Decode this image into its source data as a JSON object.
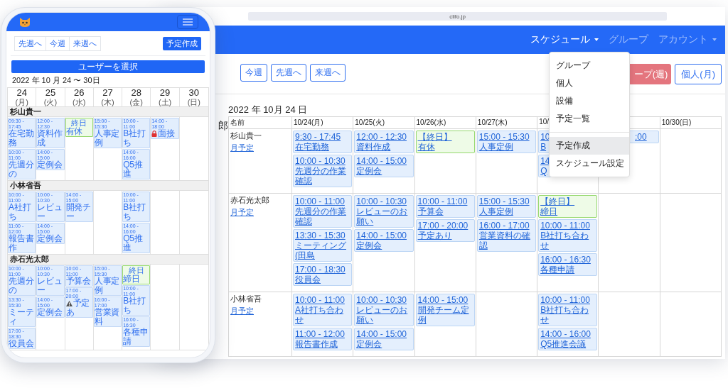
{
  "browser": {
    "url": "clifo.jp"
  },
  "navbar": {
    "items": [
      {
        "label": "スケジュール",
        "active": true,
        "dropdown": true
      },
      {
        "label": "グループ",
        "active": false,
        "dropdown": false
      },
      {
        "label": "アカウント",
        "active": false,
        "dropdown": true
      }
    ]
  },
  "dropdown": {
    "sections": [
      [
        {
          "label": "グループ",
          "selected": false
        },
        {
          "label": "個人",
          "selected": false
        },
        {
          "label": "設備",
          "selected": false
        },
        {
          "label": "予定一覧",
          "selected": false
        }
      ],
      [
        {
          "label": "予定作成",
          "selected": true
        },
        {
          "label": "スケジュール設定",
          "selected": false
        }
      ]
    ]
  },
  "toolbar": {
    "nav_buttons": [
      "今週",
      "先週へ",
      "来週へ"
    ],
    "view_buttons": [
      {
        "label": "ープ(週)",
        "selected": true
      },
      {
        "label": "個人(月)",
        "selected": false
      }
    ]
  },
  "sidebar_fragment": "郎",
  "date_title": "2022 年 10月 24 日",
  "table": {
    "columns": [
      {
        "label": "名前"
      },
      {
        "label": "10/24(月)"
      },
      {
        "label": "10/25(火)"
      },
      {
        "label": "10/26(水)"
      },
      {
        "label": "10/27(木)"
      },
      {
        "label": "10/"
      },
      {},
      {
        "label": "10/30(日)"
      }
    ],
    "rows": [
      {
        "name": "杉山貴一",
        "link": "月予定",
        "days": [
          {
            "events": [
              {
                "kind": "timed",
                "time": "9:30 - 17:45",
                "title": "在宅勤務"
              },
              {
                "kind": "timed",
                "time": "10:00 - 10:30",
                "title": "先週分の作業確認"
              }
            ]
          },
          {
            "events": [
              {
                "kind": "timed",
                "time": "12:00 - 12:30",
                "title": "資料作成"
              },
              {
                "kind": "timed",
                "time": "14:00 - 15:00",
                "title": "定例会"
              }
            ]
          },
          {
            "events": [
              {
                "kind": "allday",
                "time": "【終日】",
                "title": "有休"
              }
            ]
          },
          {
            "events": [
              {
                "kind": "timed",
                "time": "15:00 - 15:30",
                "title": "人事定例"
              }
            ]
          },
          {
            "events": [
              {
                "kind": "cut_right",
                "time": "10",
                "title": "B"
              },
              {
                "kind": "cut_right",
                "time": "14",
                "title": "Q"
              }
            ]
          },
          {
            "events": [
              {
                "kind": "cut_left",
                "time": ":00"
              }
            ]
          }
        ]
      },
      {
        "name": "赤石光太郎",
        "link": "月予定",
        "days": [
          {
            "events": [
              {
                "kind": "timed",
                "time": "10:00 - 11:00",
                "title": "先週分の作業確認"
              },
              {
                "kind": "timed",
                "time": "13:30 - 15:30",
                "title": "ミーティング(田島"
              },
              {
                "kind": "timed",
                "time": "17:00 - 18:30",
                "title": "役員会"
              }
            ]
          },
          {
            "events": [
              {
                "kind": "timed",
                "time": "10:00 - 10:30",
                "title": "レビューのお願い"
              },
              {
                "kind": "timed",
                "time": "14:00 - 15:00",
                "title": "定例会"
              }
            ]
          },
          {
            "events": [
              {
                "kind": "timed",
                "time": "10:00 - 11:00",
                "title": "予算会"
              },
              {
                "kind": "timed",
                "time": "17:00 - 20:00",
                "title": "予定あり"
              }
            ]
          },
          {
            "events": [
              {
                "kind": "timed",
                "time": "15:00 - 15:30",
                "title": "人事定例"
              },
              {
                "kind": "timed",
                "time": "16:00 - 17:00",
                "title": "営業資料の確認"
              }
            ]
          },
          {
            "events": [
              {
                "kind": "allday",
                "time": "【終日】",
                "title": "締日"
              },
              {
                "kind": "timed",
                "time": "10:00 - 11:00",
                "title": "B社打ち合わせ"
              },
              {
                "kind": "timed",
                "time": "16:00 - 16:30",
                "title": "各種申請"
              }
            ]
          }
        ]
      },
      {
        "name": "小林省吾",
        "link": "月予定",
        "days": [
          {
            "events": [
              {
                "kind": "timed",
                "time": "10:00 - 11:00",
                "title": "A社打ち合わせ"
              },
              {
                "kind": "timed",
                "time": "11:00 - 12:00",
                "title": "報告書作成"
              }
            ]
          },
          {
            "events": [
              {
                "kind": "timed",
                "time": "10:00 - 10:30",
                "title": "レビューのお願い"
              },
              {
                "kind": "timed",
                "time": "14:00 - 15:00",
                "title": "定例会"
              }
            ]
          },
          {
            "events": [
              {
                "kind": "timed",
                "time": "14:00 - 15:00",
                "title": "開発チーム定例"
              }
            ]
          },
          {
            "gap_before": true,
            "events": [
              {
                "kind": "timed",
                "time": "10:00 - 11:00",
                "title": "B社打ち合わせ"
              },
              {
                "kind": "timed",
                "time": "14:00 - 16:00",
                "title": "Q5推進会議"
              }
            ]
          }
        ]
      }
    ]
  },
  "phone": {
    "nav_buttons": [
      "先週へ",
      "今週",
      "来週へ"
    ],
    "create_button": "予定作成",
    "user_select_button": "ユーザーを選択",
    "date_range": "2022 年 10 月 24 〜 30日",
    "days": [
      {
        "day": "24",
        "weekday": "(月)"
      },
      {
        "day": "25",
        "weekday": "(火)"
      },
      {
        "day": "26",
        "weekday": "(水)"
      },
      {
        "day": "27",
        "weekday": "(木)"
      },
      {
        "day": "28",
        "weekday": "(金)"
      },
      {
        "day": "29",
        "weekday": "(土)"
      },
      {
        "day": "30",
        "weekday": "(日)"
      }
    ],
    "groups": [
      {
        "name": "杉山貴一",
        "days": [
          {
            "events": [
              {
                "kind": "timed",
                "time": "09:30 - 17:45",
                "title": "在宅勤務"
              },
              {
                "kind": "timed",
                "time": "10:00 - 11:00",
                "title": "先週分の"
              }
            ]
          },
          {
            "events": [
              {
                "kind": "timed",
                "time": "12:00 - 12:30",
                "title": "資料作成"
              },
              {
                "kind": "timed",
                "time": "14:00 - 15:00",
                "title": "定例会"
              }
            ]
          },
          {
            "events": [
              {
                "kind": "allday",
                "time": "終日",
                "title": "有休"
              }
            ]
          },
          {
            "events": [
              {
                "kind": "timed",
                "time": "15:00 - 15:30",
                "title": "人事定例"
              }
            ]
          },
          {
            "events": [
              {
                "kind": "timed",
                "time": "10:00 - 11:00",
                "title": "B社打ち"
              },
              {
                "kind": "timed",
                "time": "14:00 - 16:00",
                "title": "Q5推進"
              }
            ]
          },
          {
            "events": [
              {
                "kind": "locked",
                "time": "14:00 - 18:00",
                "title": "面接"
              }
            ]
          }
        ]
      },
      {
        "name": "小林省吾",
        "days": [
          {
            "events": [
              {
                "kind": "timed",
                "time": "10:00 - 11:00",
                "title": "A社打ち"
              },
              {
                "kind": "timed",
                "time": "11:00 - 12:00",
                "title": "報告書作"
              }
            ]
          },
          {
            "events": [
              {
                "kind": "timed",
                "time": "10:00 - 10:30",
                "title": "レビュー"
              },
              {
                "kind": "timed",
                "time": "14:00 - 15:00",
                "title": "定例会"
              }
            ]
          },
          {
            "events": [
              {
                "kind": "timed",
                "time": "14:00 - 15:00",
                "title": "開発チー"
              }
            ]
          },
          {
            "gap_before": true,
            "events": [
              {
                "kind": "timed",
                "time": "10:00 - 11:00",
                "title": "B社打ち"
              },
              {
                "kind": "timed",
                "time": "14:00 - 16:00",
                "title": "Q5推進"
              }
            ]
          }
        ]
      },
      {
        "name": "赤石光太郎",
        "days": [
          {
            "events": [
              {
                "kind": "timed",
                "time": "10:00 - 11:00",
                "title": "先週分の"
              },
              {
                "kind": "timed",
                "time": "13:30 - 15:30",
                "title": "ミーティ"
              },
              {
                "kind": "timed",
                "time": "17:00 - 18:30",
                "title": "役員会"
              }
            ]
          },
          {
            "events": [
              {
                "kind": "timed",
                "time": "10:00 - 10:30",
                "title": "レビュー"
              },
              {
                "kind": "timed",
                "time": "14:00 - 15:00",
                "title": "定例会"
              }
            ]
          },
          {
            "events": [
              {
                "kind": "timed",
                "time": "10:00 - 11:00",
                "title": "予算会"
              },
              {
                "kind": "warning",
                "time": "17:00 - 20:00",
                "title": "予定あ"
              }
            ]
          },
          {
            "events": [
              {
                "kind": "timed",
                "time": "15:00 - 15:30",
                "title": "人事定例"
              },
              {
                "kind": "timed",
                "time": "16:00 - 17:00",
                "title": "営業資料"
              }
            ]
          },
          {
            "events": [
              {
                "kind": "allday",
                "time": "終日",
                "title": "締日"
              },
              {
                "kind": "timed",
                "time": "10:00 - 11:00",
                "title": "B社打ち"
              },
              {
                "kind": "timed",
                "time": "16:00 - 16:30",
                "title": "各種申請"
              }
            ]
          }
        ]
      }
    ]
  }
}
